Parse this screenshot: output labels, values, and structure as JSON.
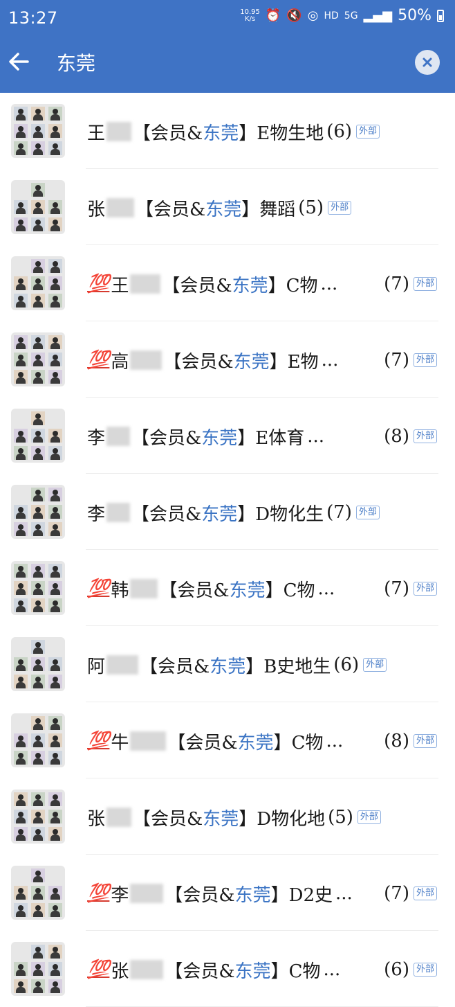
{
  "status_bar": {
    "time": "13:27",
    "speed_top": "10.95",
    "speed_bottom": "K/s",
    "hd": "HD",
    "net": "5G",
    "battery": "50%"
  },
  "search": {
    "query": "东莞",
    "back_icon": "back-arrow-icon",
    "clear_icon": "clear-icon"
  },
  "results": [
    {
      "prefix": "",
      "name_first": "王",
      "blur_w": 36,
      "group_pre": "会员&",
      "group_kw": "东莞",
      "suffix": "E物生地",
      "ellipsis": "",
      "count": "(6)",
      "badge": "外部"
    },
    {
      "prefix": "",
      "name_first": "张",
      "blur_w": 40,
      "group_pre": "会员&",
      "group_kw": "东莞",
      "suffix": "舞蹈",
      "ellipsis": "",
      "count": "(5)",
      "badge": "外部"
    },
    {
      "prefix": "💯",
      "name_first": "王",
      "blur_w": 44,
      "group_pre": "会员&",
      "group_kw": "东莞",
      "suffix": "C物",
      "ellipsis": "...",
      "count": "(7)",
      "badge": "外部"
    },
    {
      "prefix": "💯",
      "name_first": "高",
      "blur_w": 46,
      "group_pre": "会员&",
      "group_kw": "东莞",
      "suffix": "E物",
      "ellipsis": "...",
      "count": "(7)",
      "badge": "外部"
    },
    {
      "prefix": "",
      "name_first": "李",
      "blur_w": 34,
      "group_pre": "会员&",
      "group_kw": "东莞",
      "suffix": "E体育",
      "ellipsis": "...",
      "count": "(8)",
      "badge": "外部"
    },
    {
      "prefix": "",
      "name_first": "李",
      "blur_w": 34,
      "group_pre": "会员&",
      "group_kw": "东莞",
      "suffix": "D物化生",
      "ellipsis": "",
      "count": "(7)",
      "badge": "外部"
    },
    {
      "prefix": "💯",
      "name_first": "韩",
      "blur_w": 40,
      "group_pre": "会员&",
      "group_kw": "东莞",
      "suffix": "C物",
      "ellipsis": "...",
      "count": "(7)",
      "badge": "外部"
    },
    {
      "prefix": "",
      "name_first": "阿",
      "blur_w": 46,
      "group_pre": "会员&",
      "group_kw": "东莞",
      "suffix": "B史地生",
      "ellipsis": "",
      "count": "(6)",
      "badge": "外部"
    },
    {
      "prefix": "💯",
      "name_first": "牛",
      "blur_w": 52,
      "group_pre": "会员&",
      "group_kw": "东莞",
      "suffix": "C物",
      "ellipsis": "...",
      "count": "(8)",
      "badge": "外部"
    },
    {
      "prefix": "",
      "name_first": "张",
      "blur_w": 36,
      "group_pre": "会员&",
      "group_kw": "东莞",
      "suffix": "D物化地",
      "ellipsis": "",
      "count": "(5)",
      "badge": "外部"
    },
    {
      "prefix": "💯",
      "name_first": "李",
      "blur_w": 48,
      "group_pre": "会员&",
      "group_kw": "东莞",
      "suffix": "D2史",
      "ellipsis": "...",
      "count": "(7)",
      "badge": "外部"
    },
    {
      "prefix": "💯",
      "name_first": "张",
      "blur_w": 48,
      "group_pre": "会员&",
      "group_kw": "东莞",
      "suffix": "C物",
      "ellipsis": "...",
      "count": "(6)",
      "badge": "外部"
    }
  ],
  "colors": {
    "header": "#3f73c5",
    "keyword": "#3b74c4",
    "badge": "#4d7fc8"
  }
}
